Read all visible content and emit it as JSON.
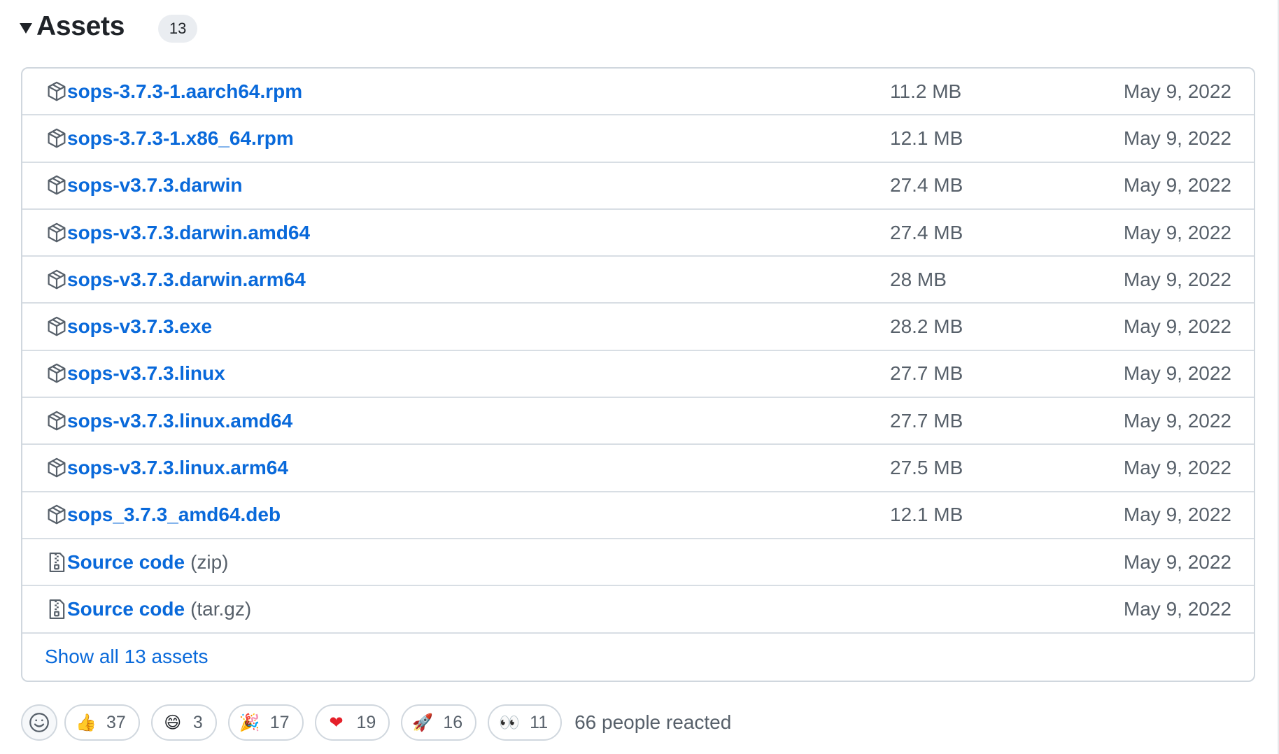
{
  "assets_section": {
    "title": "Assets",
    "count": "13"
  },
  "assets": [
    {
      "name": "sops-3.7.3-1.aarch64.rpm",
      "suffix": "",
      "size": "11.2 MB",
      "date": "May 9, 2022",
      "icon": "package-icon"
    },
    {
      "name": "sops-3.7.3-1.x86_64.rpm",
      "suffix": "",
      "size": "12.1 MB",
      "date": "May 9, 2022",
      "icon": "package-icon"
    },
    {
      "name": "sops-v3.7.3.darwin",
      "suffix": "",
      "size": "27.4 MB",
      "date": "May 9, 2022",
      "icon": "package-icon"
    },
    {
      "name": "sops-v3.7.3.darwin.amd64",
      "suffix": "",
      "size": "27.4 MB",
      "date": "May 9, 2022",
      "icon": "package-icon"
    },
    {
      "name": "sops-v3.7.3.darwin.arm64",
      "suffix": "",
      "size": "28 MB",
      "date": "May 9, 2022",
      "icon": "package-icon"
    },
    {
      "name": "sops-v3.7.3.exe",
      "suffix": "",
      "size": "28.2 MB",
      "date": "May 9, 2022",
      "icon": "package-icon"
    },
    {
      "name": "sops-v3.7.3.linux",
      "suffix": "",
      "size": "27.7 MB",
      "date": "May 9, 2022",
      "icon": "package-icon"
    },
    {
      "name": "sops-v3.7.3.linux.amd64",
      "suffix": "",
      "size": "27.7 MB",
      "date": "May 9, 2022",
      "icon": "package-icon"
    },
    {
      "name": "sops-v3.7.3.linux.arm64",
      "suffix": "",
      "size": "27.5 MB",
      "date": "May 9, 2022",
      "icon": "package-icon"
    },
    {
      "name": "sops_3.7.3_amd64.deb",
      "suffix": "",
      "size": "12.1 MB",
      "date": "May 9, 2022",
      "icon": "package-icon"
    },
    {
      "name": "Source code",
      "suffix": "(zip)",
      "size": "",
      "date": "May 9, 2022",
      "icon": "file-zip-icon"
    },
    {
      "name": "Source code",
      "suffix": "(tar.gz)",
      "size": "",
      "date": "May 9, 2022",
      "icon": "file-zip-icon"
    }
  ],
  "show_all_label": "Show all 13 assets",
  "reactions": {
    "add_icon": "smiley-icon",
    "items": [
      {
        "emoji": "👍",
        "icon": "thumbs-up-icon",
        "count": "37"
      },
      {
        "emoji": "😄",
        "icon": "laugh-icon",
        "count": "3"
      },
      {
        "emoji": "🎉",
        "icon": "hooray-icon",
        "count": "17"
      },
      {
        "emoji": "❤",
        "icon": "heart-icon",
        "count": "19"
      },
      {
        "emoji": "🚀",
        "icon": "rocket-icon",
        "count": "16"
      },
      {
        "emoji": "👀",
        "icon": "eyes-icon",
        "count": "11"
      }
    ],
    "summary": "66 people reacted"
  },
  "colors": {
    "link": "#0969da",
    "muted": "#57606a",
    "border": "#d0d7de",
    "heart": "#e5202a"
  }
}
